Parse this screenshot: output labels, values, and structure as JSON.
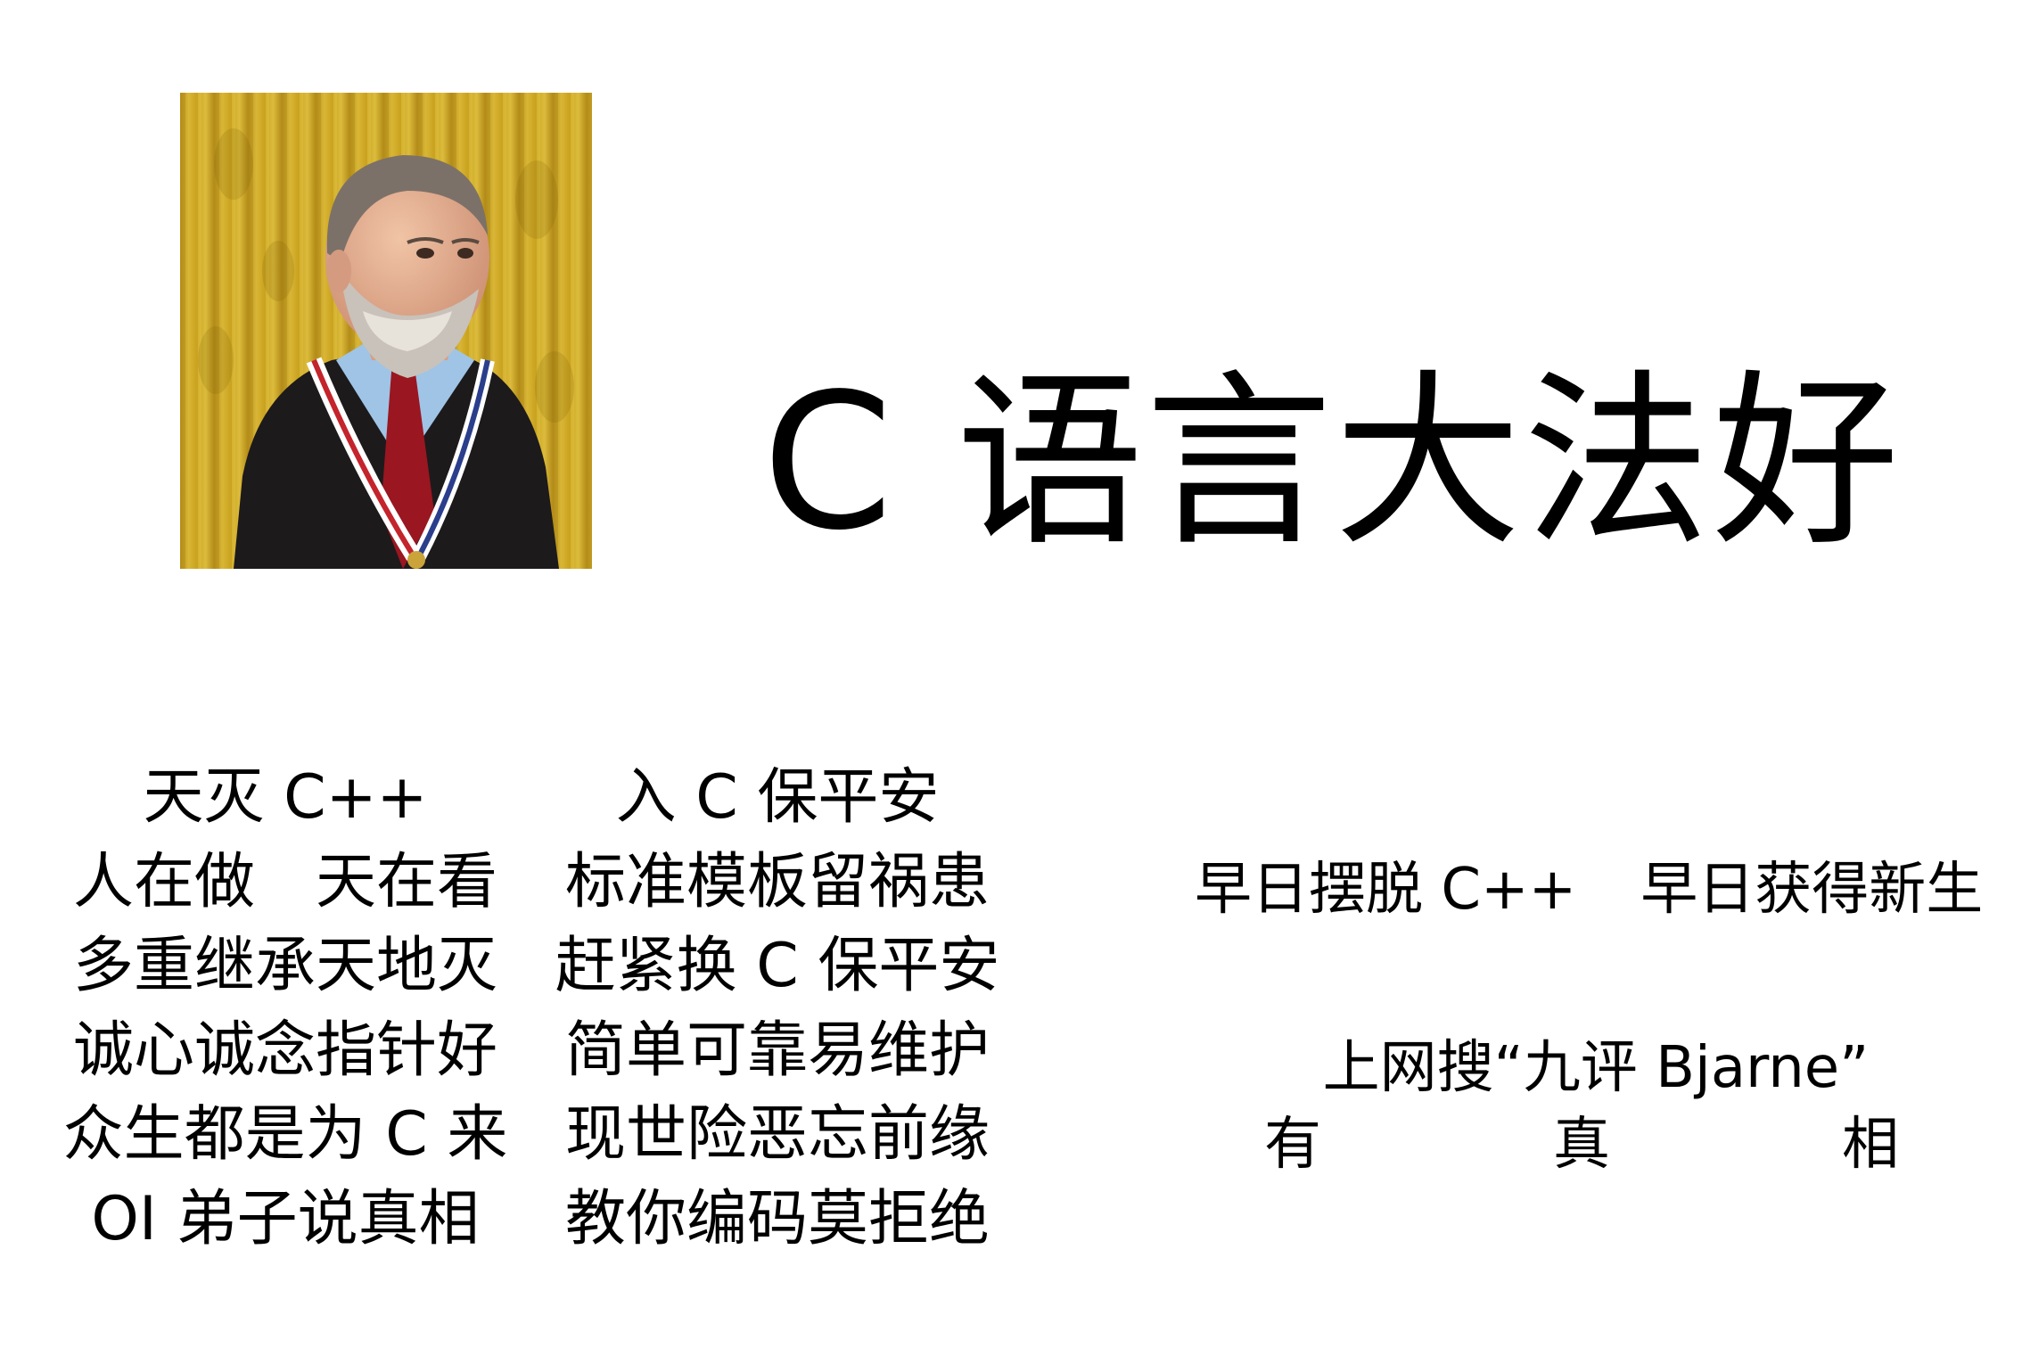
{
  "title": "C 语言大法好",
  "poem_left": [
    "天灭 C++",
    "人在做　天在看",
    "多重继承天地灭",
    "诚心诚念指针好",
    "众生都是为 C 来",
    "OI 弟子说真相"
  ],
  "poem_right": [
    "入 C 保平安",
    "标准模板留祸患",
    "赶紧换 C 保平安",
    "简单可靠易维护",
    "现世险恶忘前缘",
    "教你编码莫拒绝"
  ],
  "slogan": {
    "part1": "早日摆脱 C++",
    "part2": "早日获得新生"
  },
  "search": {
    "text": "上网搜“九评 Bjarne”",
    "truth": [
      "有",
      "真",
      "相"
    ]
  },
  "colors": {
    "background": "#ffffff",
    "text": "#000000",
    "curtain": "#c9a21e",
    "suit": "#1d1a1c",
    "tie": "#9a1620"
  }
}
